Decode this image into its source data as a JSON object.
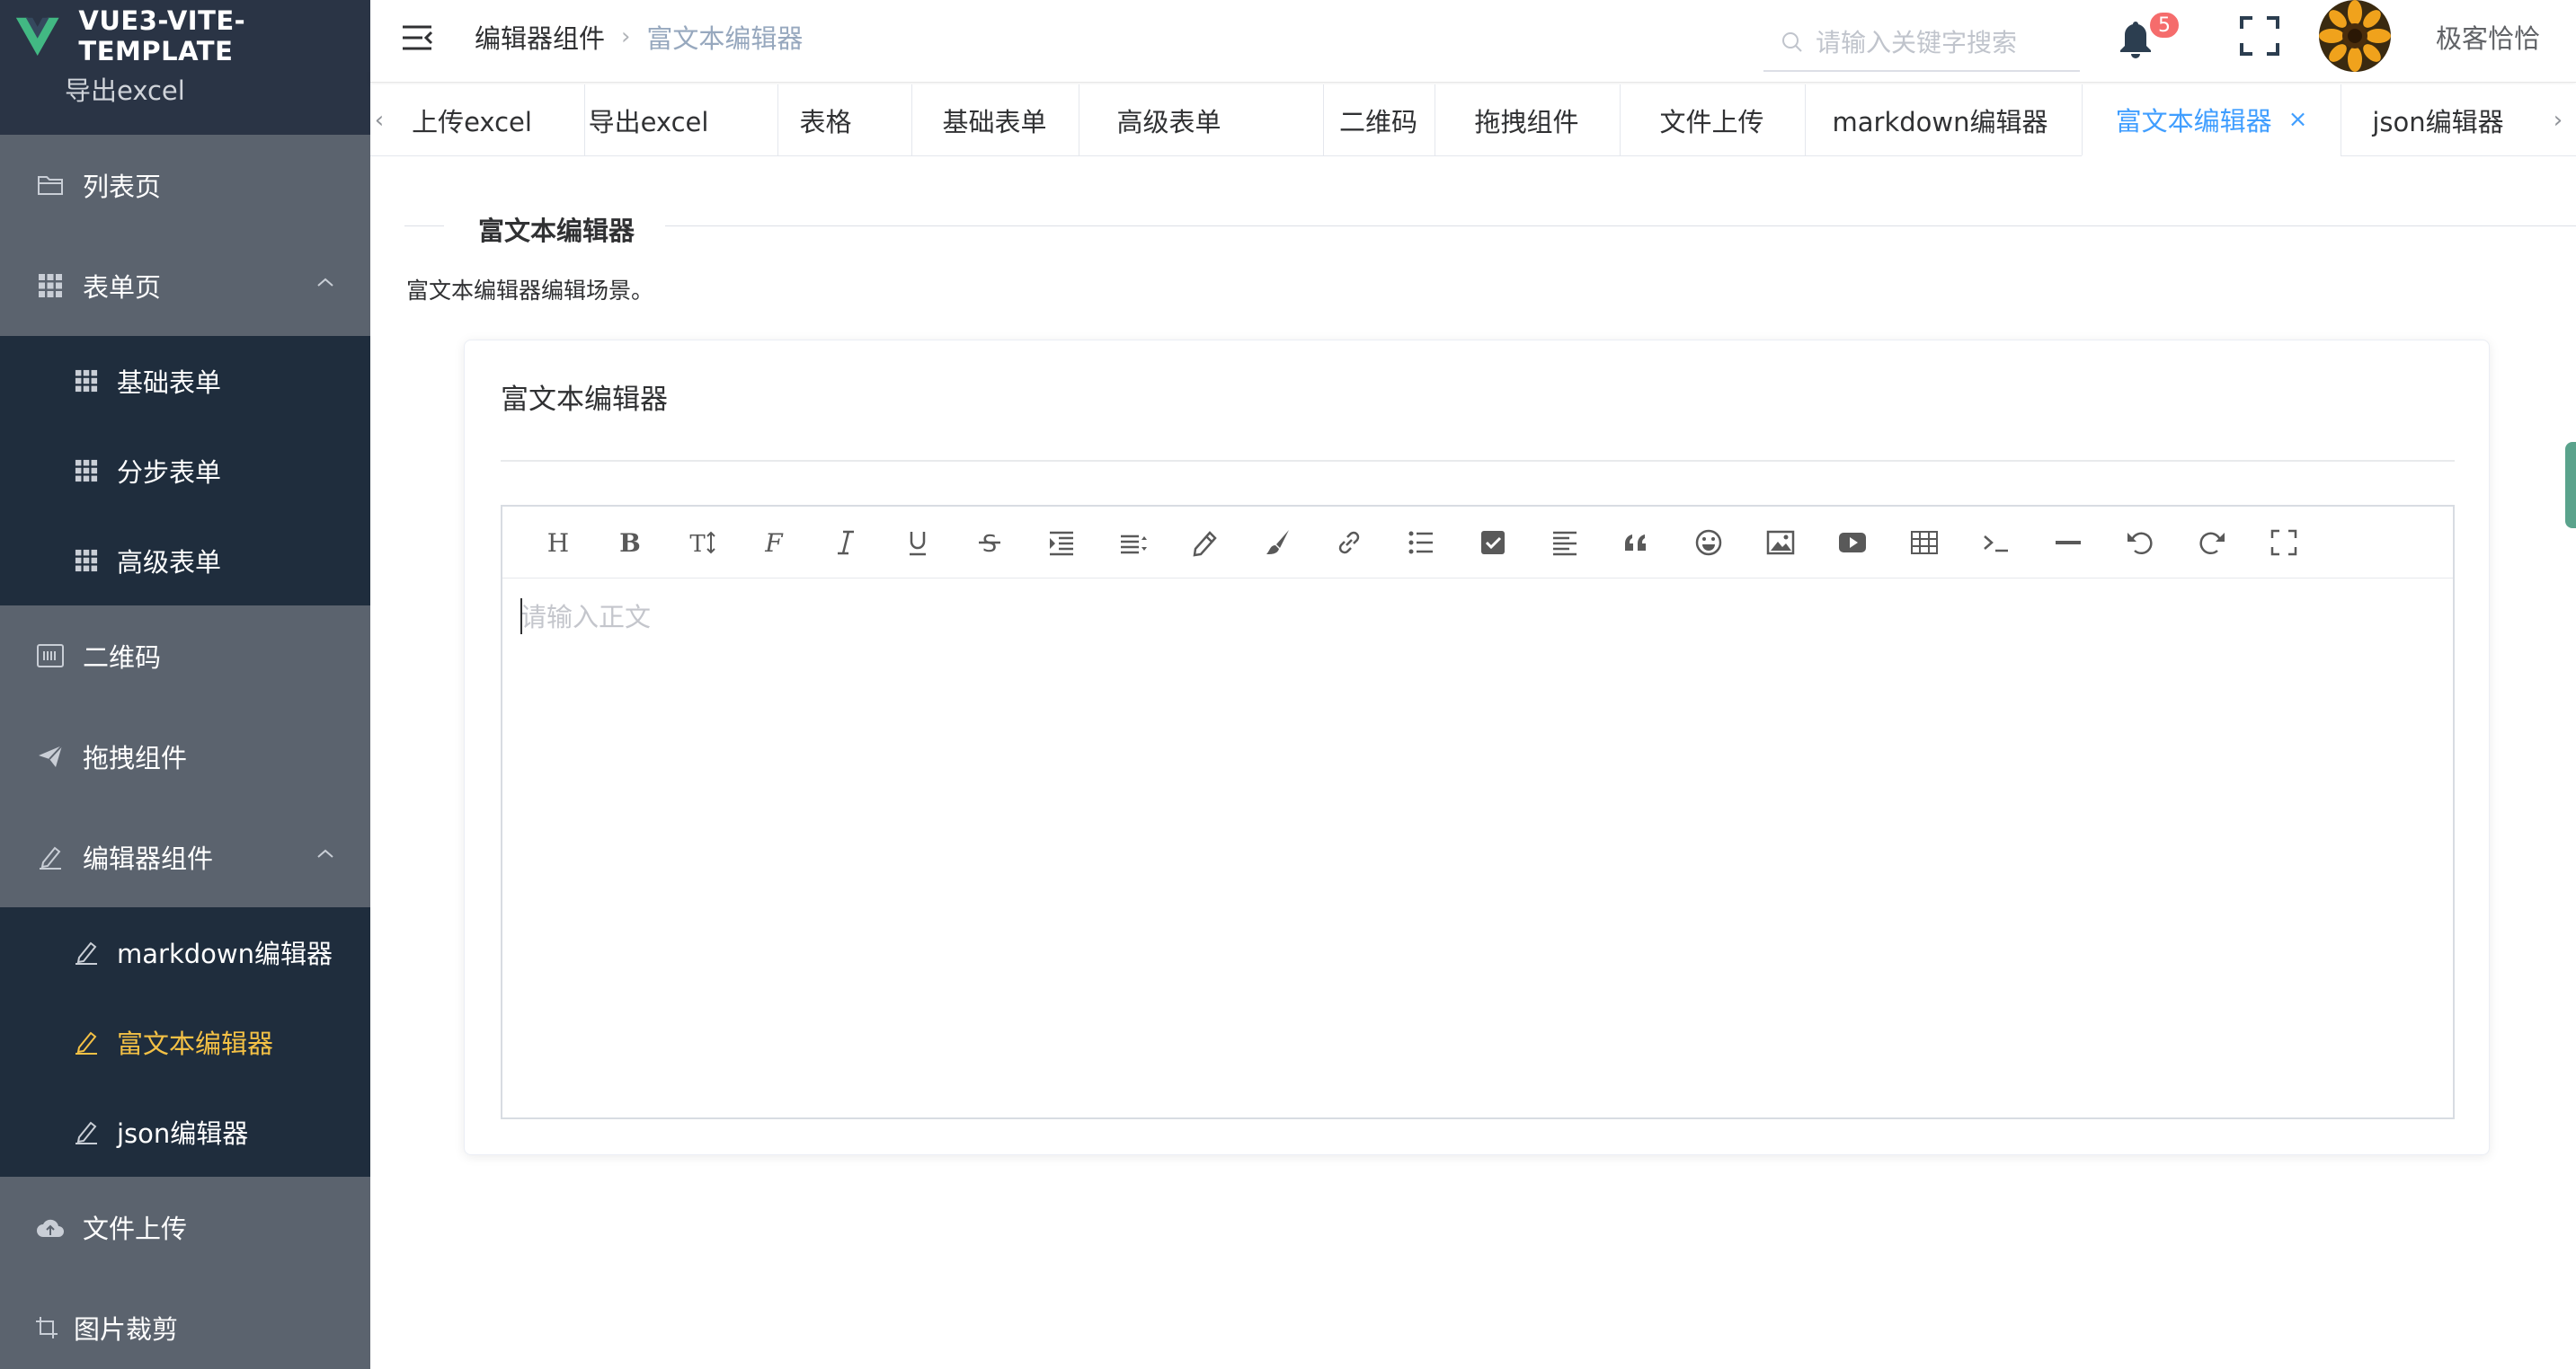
{
  "app": {
    "title": "VUE3-VITE-TEMPLATE",
    "brand_color": "#42b883"
  },
  "sidebar": {
    "cutoff_item": "导出excel",
    "items": [
      {
        "label": "列表页",
        "icon": "folder-icon"
      },
      {
        "label": "表单页",
        "icon": "grid-icon",
        "expanded": true
      },
      {
        "label": "二维码",
        "icon": "qrcode-icon"
      },
      {
        "label": "拖拽组件",
        "icon": "paper-plane-icon"
      },
      {
        "label": "编辑器组件",
        "icon": "edit-icon",
        "expanded": true
      },
      {
        "label": "文件上传",
        "icon": "cloud-upload-icon"
      },
      {
        "label": "图片裁剪",
        "icon": "crop-icon"
      }
    ],
    "form_sub": [
      {
        "label": "基础表单",
        "icon": "grid-icon"
      },
      {
        "label": "分步表单",
        "icon": "grid-icon"
      },
      {
        "label": "高级表单",
        "icon": "grid-icon"
      }
    ],
    "editor_sub": [
      {
        "label": "markdown编辑器",
        "icon": "edit-icon"
      },
      {
        "label": "富文本编辑器",
        "icon": "edit-icon",
        "active": true
      },
      {
        "label": "json编辑器",
        "icon": "edit-icon"
      }
    ],
    "active_color": "#f4c145"
  },
  "header": {
    "breadcrumb": [
      "编辑器组件",
      "富文本编辑器"
    ],
    "search_placeholder": "请输入关键字搜索",
    "notification_count": "5",
    "username": "极客恰恰"
  },
  "tags": [
    {
      "label": "上传excel"
    },
    {
      "label": "导出excel"
    },
    {
      "label": "表格"
    },
    {
      "label": "基础表单"
    },
    {
      "label": "高级表单"
    },
    {
      "label": "二维码"
    },
    {
      "label": "拖拽组件"
    },
    {
      "label": "文件上传"
    },
    {
      "label": "markdown编辑器"
    },
    {
      "label": "富文本编辑器",
      "active": true,
      "close": "×"
    },
    {
      "label": "json编辑器"
    }
  ],
  "main": {
    "section_title": "富文本编辑器",
    "description": "富文本编辑器编辑场景。",
    "card_title": "富文本编辑器",
    "editor_placeholder": "请输入正文",
    "toolbar": [
      "heading-icon",
      "bold-icon",
      "font-size-icon",
      "font-family-icon",
      "italic-icon",
      "underline-icon",
      "strikethrough-icon",
      "indent-icon",
      "line-height-icon",
      "text-color-icon",
      "background-color-icon",
      "link-icon",
      "list-icon",
      "todo-icon",
      "align-icon",
      "quote-icon",
      "emoticon-icon",
      "image-icon",
      "video-icon",
      "table-icon",
      "code-icon",
      "divider-icon",
      "undo-icon",
      "redo-icon",
      "fullscreen-icon"
    ],
    "accent_color": "#409eff"
  }
}
